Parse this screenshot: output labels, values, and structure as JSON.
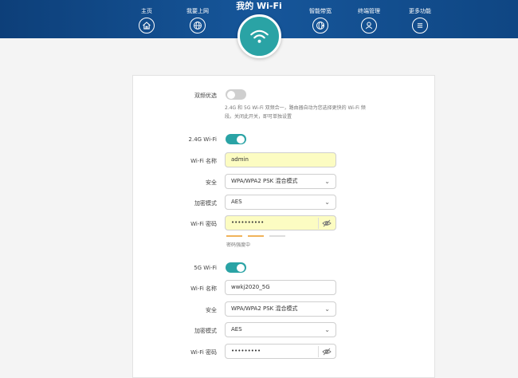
{
  "nav": {
    "items": [
      {
        "label": "主页",
        "icon": "home-icon"
      },
      {
        "label": "我要上网",
        "icon": "globe-icon"
      },
      {
        "label": "智能带宽",
        "icon": "bandwidth-globe-icon"
      },
      {
        "label": "终端管理",
        "icon": "user-icon"
      },
      {
        "label": "更多功能",
        "icon": "menu-icon"
      }
    ],
    "title": "我的 Wi-Fi",
    "active_icon": "wifi-icon"
  },
  "settings": {
    "dual_band": {
      "label": "双频优选",
      "enabled": false
    },
    "note_line1": "2.4G 和 5G Wi-Fi 双频合一，路由器自动为您选择更快的 Wi-Fi 频",
    "note_line2": "段。关闭此开关，即可单独设置",
    "band24": {
      "title": "2.4G Wi-Fi",
      "enabled": true,
      "name_label": "Wi-Fi 名称",
      "name_value": "admin",
      "security_label": "安全",
      "security_value": "WPA/WPA2 PSK 混合模式",
      "encryption_label": "加密模式",
      "encryption_value": "AES",
      "password_label": "Wi-Fi 密码",
      "password_value": "••••••••••",
      "strength_label": "密码强度中",
      "strength_level": 2,
      "strength_max": 3
    },
    "band5": {
      "title": "5G Wi-Fi",
      "enabled": true,
      "name_label": "Wi-Fi 名称",
      "name_value": "wwkj2020_5G",
      "security_label": "安全",
      "security_value": "WPA/WPA2 PSK 混合模式",
      "encryption_label": "加密模式",
      "encryption_value": "AES",
      "password_label": "Wi-Fi 密码",
      "password_value": "•••••••••"
    }
  },
  "colors": {
    "header": "#14508f",
    "accent": "#2aa3a5",
    "strength_active": "#f0b35a",
    "strength_inactive": "#dddddd",
    "autofill": "#fcfcc2"
  }
}
